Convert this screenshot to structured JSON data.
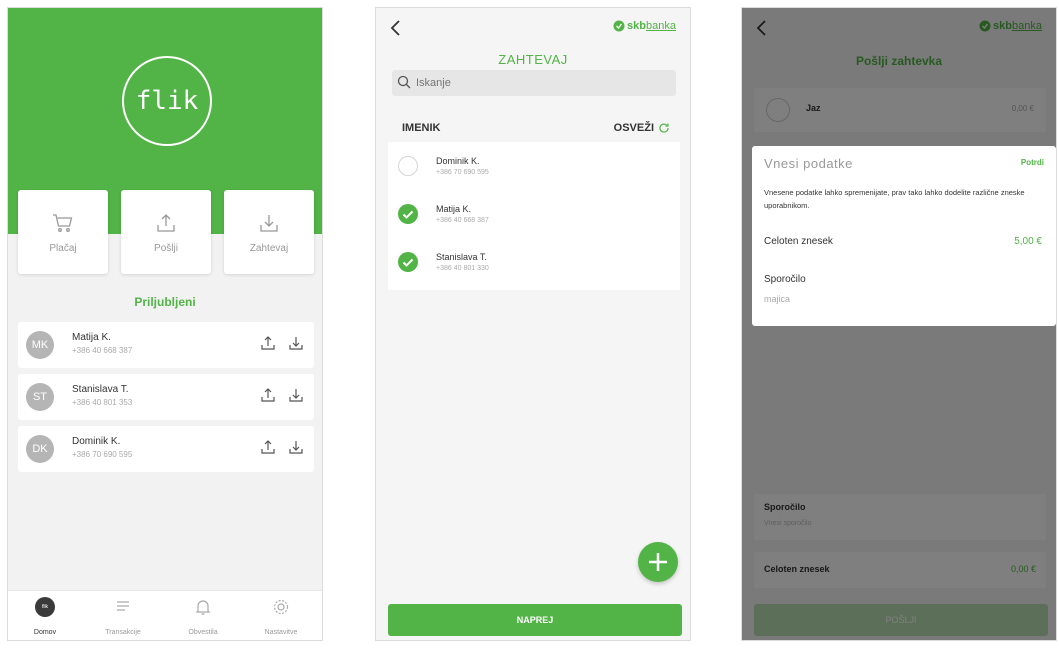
{
  "colors": {
    "brand_green": "#52b346",
    "overlay": "rgba(0,0,0,0.5)"
  },
  "home": {
    "logo_text": "flik",
    "actions": [
      {
        "label": "Plačaj",
        "icon": "cart-icon"
      },
      {
        "label": "Pošlji",
        "icon": "upload-icon"
      },
      {
        "label": "Zahtevaj",
        "icon": "download-icon"
      }
    ],
    "section_title": "Priljubljeni",
    "favorites": [
      {
        "initials": "MK",
        "name": "Matija K.",
        "phone": "+386 40 668 387"
      },
      {
        "initials": "ST",
        "name": "Stanislava T.",
        "phone": "+386 40 801 353"
      },
      {
        "initials": "DK",
        "name": "Dominik K.",
        "phone": "+386 70 690 595"
      }
    ],
    "nav": [
      {
        "label": "Domov",
        "icon": "flik-home-icon",
        "active": true,
        "dot_text": "flik"
      },
      {
        "label": "Transakcije",
        "icon": "list-icon"
      },
      {
        "label": "Obvestila",
        "icon": "bell-icon"
      },
      {
        "label": "Nastavitve",
        "icon": "gear-icon"
      }
    ]
  },
  "request": {
    "brand_bold": "skb",
    "brand_thin": "banka",
    "title": "ZAHTEVAJ",
    "search_placeholder": "Iskanje",
    "contacts_header": "IMENIK",
    "refresh_label": "OSVEŽI",
    "contacts": [
      {
        "name": "Dominik K.",
        "phone": "+386 70 690 595",
        "selected": false
      },
      {
        "name": "Matija K.",
        "phone": "+386 40 668 387",
        "selected": true
      },
      {
        "name": "Stanislava T.",
        "phone": "+386 40 801 330",
        "selected": true
      }
    ],
    "next_button": "NAPREJ"
  },
  "send_request": {
    "brand_bold": "skb",
    "brand_thin": "banka",
    "title": "Pošlji zahtevka",
    "me_label": "Jaz",
    "me_amount": "0,00 €",
    "message_label": "Sporočilo",
    "message_placeholder": "Vnesi sporočilo",
    "total_label": "Celoten znesek",
    "total_value": "0,00 €",
    "send_button": "POŠLJI",
    "modal": {
      "title": "Vnesi podatke",
      "confirm": "Potrdi",
      "description": "Vnesene podatke lahko spremenijate, prav tako lahko dodelite različne zneske uporabnikom.",
      "amount_label": "Celoten znesek",
      "amount_value": "5,00 €",
      "message_label": "Sporočilo",
      "message_value": "majica"
    }
  }
}
